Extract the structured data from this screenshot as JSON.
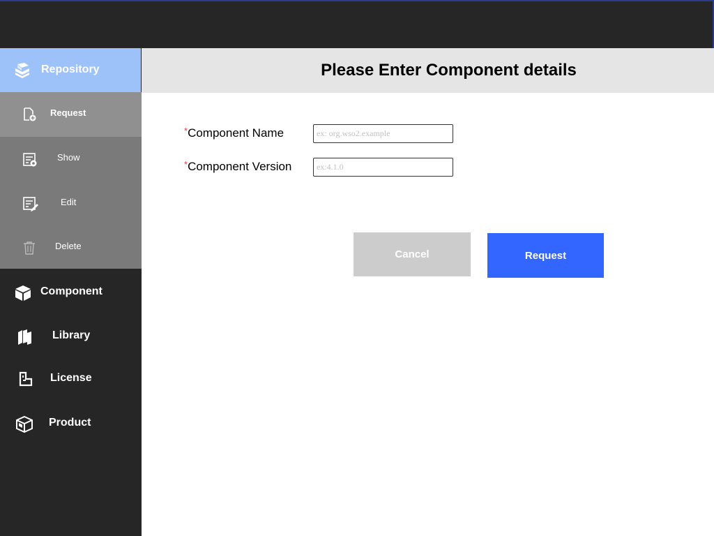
{
  "sidebar": {
    "repository": {
      "label": "Repository",
      "icon": "books-icon"
    },
    "repository_items": [
      {
        "label": "Request",
        "icon": "file-add-icon"
      },
      {
        "label": "Show",
        "icon": "file-view-icon"
      },
      {
        "label": "Edit",
        "icon": "file-edit-icon"
      },
      {
        "label": "Delete",
        "icon": "trash-icon"
      }
    ],
    "items": [
      {
        "label": "Component",
        "icon": "box-icon"
      },
      {
        "label": "Library",
        "icon": "library-icon"
      },
      {
        "label": "License",
        "icon": "license-icon"
      },
      {
        "label": "Product",
        "icon": "product-icon"
      }
    ]
  },
  "header": {
    "title": "Please Enter Component details"
  },
  "form": {
    "required_marker": "*",
    "component_name": {
      "label": "Component Name",
      "placeholder": "ex: org.wso2.example",
      "value": ""
    },
    "component_version": {
      "label": "Component Version",
      "placeholder": "ex:4.1.0",
      "value": ""
    },
    "cancel_label": "Cancel",
    "request_label": "Request"
  },
  "colors": {
    "topbar": "#262626",
    "sidebar": "#262626",
    "repository_active": "#9dc2fa",
    "submenu": "#7a7a7a",
    "submenu_active": "#909090",
    "header_bg": "#e5e5e5",
    "cancel_button": "#cccccc",
    "request_button": "#3366ff",
    "required": "#e53935"
  }
}
